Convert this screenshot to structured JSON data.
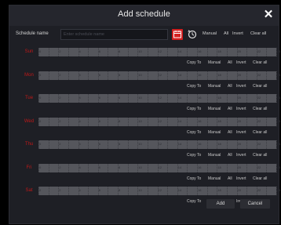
{
  "dialog": {
    "title": "Add schedule",
    "close_icon": "close-icon"
  },
  "name_row": {
    "label": "Schedule name",
    "placeholder": "Enter schedule name",
    "value": "",
    "calendar_icon": "calendar-icon",
    "clock_icon": "clock-icon",
    "manual": "Manual",
    "all": "All",
    "invert": "Invert",
    "clear_all": "Clear all"
  },
  "timeline": {
    "hours": [
      "0",
      "2",
      "4",
      "6",
      "8",
      "10",
      "12",
      "14",
      "16",
      "18",
      "20",
      "22",
      "24"
    ]
  },
  "days": [
    {
      "label": "Sun"
    },
    {
      "label": "Mon"
    },
    {
      "label": "Tue"
    },
    {
      "label": "Wed"
    },
    {
      "label": "Thu"
    },
    {
      "label": "Fri"
    },
    {
      "label": "Sat"
    }
  ],
  "day_actions": {
    "copy_to": "Copy To",
    "manual": "Manual",
    "all": "All",
    "invert": "Invert",
    "clear_all": "Clear all"
  },
  "footer": {
    "add": "Add",
    "cancel": "Cancel"
  },
  "colors": {
    "accent_red": "#d42020",
    "day_label_red": "#c01818",
    "bar_gray": "#55565c",
    "dialog_bg": "#1e1f25"
  }
}
